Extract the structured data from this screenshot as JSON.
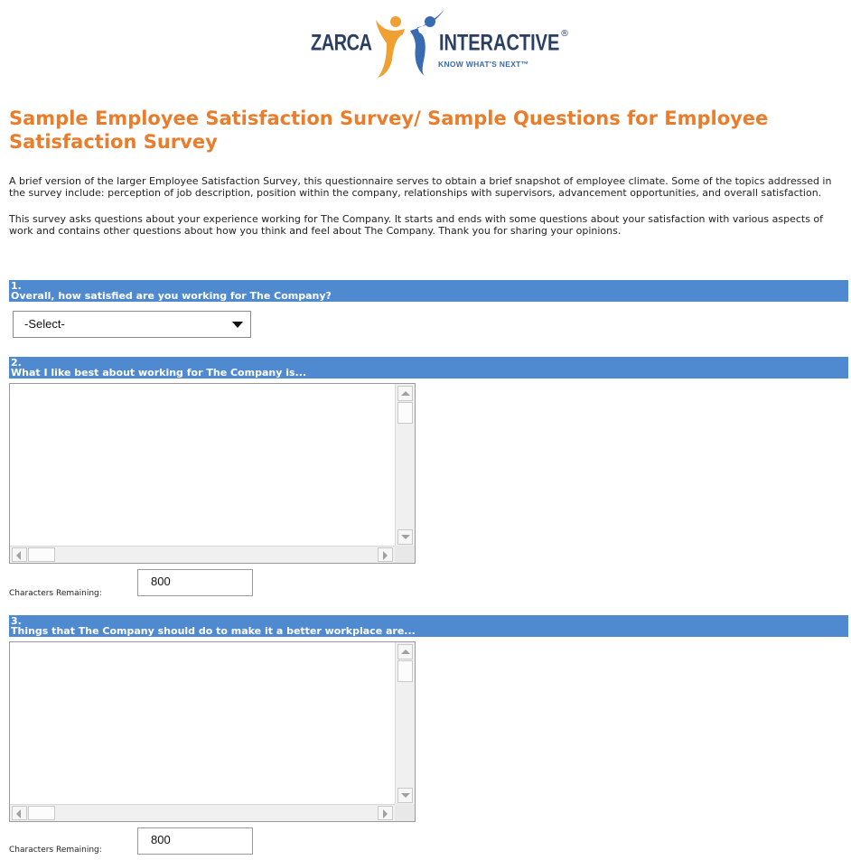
{
  "logo": {
    "left_text": "ZARCA",
    "right_text": "INTERACTIVE",
    "registered": "®",
    "tagline": "KNOW WHAT'S NEXT™"
  },
  "page_title": "Sample Employee Satisfaction Survey/ Sample Questions for Employee Satisfaction Survey",
  "intro": {
    "paragraph1": "A brief version of the larger Employee Satisfaction Survey, this questionnaire serves to obtain a brief snapshot of employee climate. Some of the topics addressed in the survey include: perception of job description, position within the company, relationships with supervisors, advancement opportunities, and overall satisfaction.",
    "paragraph2": "This survey asks questions about your experience working for The Company. It starts and ends with some questions about your satisfaction with various aspects of work and contains other questions about how you think and feel about The Company. Thank you for sharing your opinions."
  },
  "questions": [
    {
      "number": "1.",
      "text": "Overall, how satisfied are you working for The Company?",
      "select_value": "-Select-"
    },
    {
      "number": "2.",
      "text": "What I like best about working for The Company is...",
      "chars_label": "Characters Remaining:",
      "chars_value": "800"
    },
    {
      "number": "3.",
      "text": "Things that The Company should do to make it a better workplace are...",
      "chars_label": "Characters Remaining:",
      "chars_value": "800"
    }
  ],
  "colors": {
    "title": "#ea7d2c",
    "question_bar": "#4f8ad0",
    "logo_orange": "#f0a033",
    "logo_blue": "#3a6ab0"
  }
}
